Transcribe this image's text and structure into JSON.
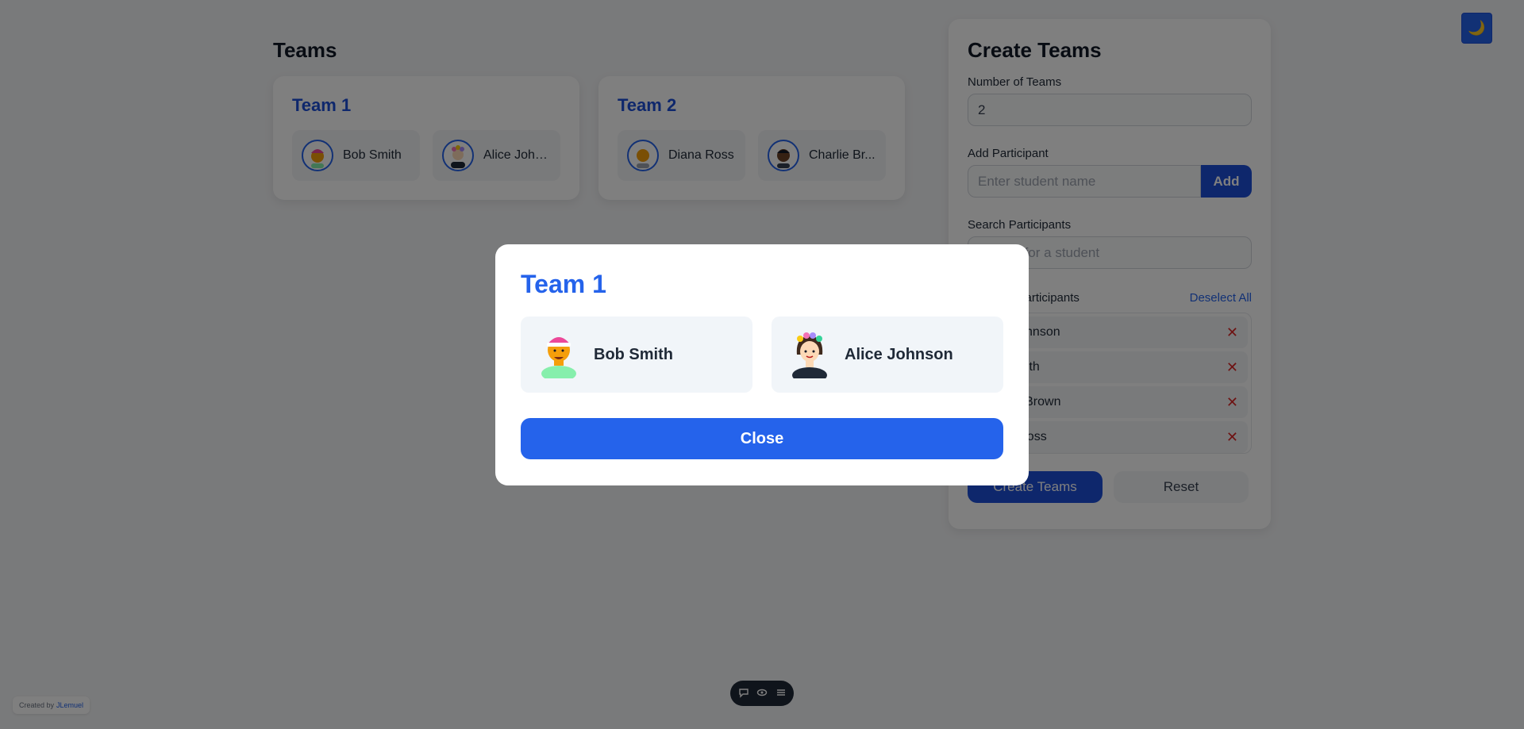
{
  "theme_toggle": {
    "icon": "moon-icon",
    "glyph": "🌙"
  },
  "teams": {
    "title": "Teams",
    "cards": [
      {
        "name": "Team 1",
        "members": [
          "Bob Smith",
          "Alice John..."
        ]
      },
      {
        "name": "Team 2",
        "members": [
          "Diana Ross",
          "Charlie Br..."
        ]
      }
    ]
  },
  "create_panel": {
    "title": "Create Teams",
    "num_teams_label": "Number of Teams",
    "num_teams_value": "2",
    "add_label": "Add Participant",
    "add_placeholder": "Enter student name",
    "add_button": "Add",
    "search_label": "Search Participants",
    "search_placeholder": "Search for a student",
    "selected_label": "Selected Participants",
    "deselect_all": "Deselect All",
    "selected": [
      "Alice Johnson",
      "Bob Smith",
      "Charlie Brown",
      "Diana Ross"
    ],
    "remove_glyph": "✕",
    "create_button": "Create Teams",
    "reset_button": "Reset"
  },
  "credit": {
    "prefix": "Created by",
    "author": "JLemuel"
  },
  "modal": {
    "title": "Team 1",
    "members": [
      "Bob Smith",
      "Alice Johnson"
    ],
    "close_button": "Close"
  },
  "colors": {
    "accent": "#2563eb",
    "accent_dark": "#1d4ed8",
    "danger": "#dc2626"
  }
}
